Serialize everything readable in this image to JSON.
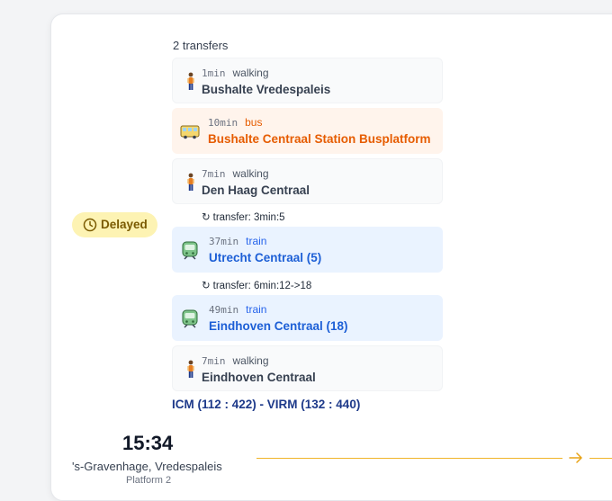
{
  "trip": {
    "transfers_label": "2 transfers",
    "status": {
      "label": "Delayed",
      "icon": "clock-icon",
      "color": "#fdf3b3"
    },
    "legs": [
      {
        "duration": "1min",
        "mode": "walking",
        "destination": "Bushalte Vredespaleis",
        "icon": "walking-person-icon"
      },
      {
        "duration": "10min",
        "mode": "bus",
        "destination": "Bushalte Centraal Station Busplatform",
        "icon": "bus-icon"
      },
      {
        "duration": "7min",
        "mode": "walking",
        "destination": "Den Haag Centraal",
        "icon": "walking-person-icon"
      },
      {
        "duration": "37min",
        "mode": "train",
        "destination": "Utrecht Centraal (5)",
        "icon": "train-icon"
      },
      {
        "duration": "49min",
        "mode": "train",
        "destination": "Eindhoven Centraal (18)",
        "icon": "train-icon"
      },
      {
        "duration": "7min",
        "mode": "walking",
        "destination": "Eindhoven Centraal",
        "icon": "walking-person-icon"
      }
    ],
    "transfer_notes": [
      {
        "symbol": "↻",
        "text": "transfer: 3min:5"
      },
      {
        "symbol": "↻",
        "text": "transfer: 6min:12->18"
      }
    ],
    "train_types": "ICM (112 : 422) - VIRM (132 : 440)",
    "departure": {
      "time": "15:34",
      "station": "'s-Gravenhage, Vredespaleis",
      "platform": "Platform 2"
    },
    "colors": {
      "bus": "#e65c00",
      "train": "#1d5fd6",
      "route_line": "#f0b429"
    }
  }
}
